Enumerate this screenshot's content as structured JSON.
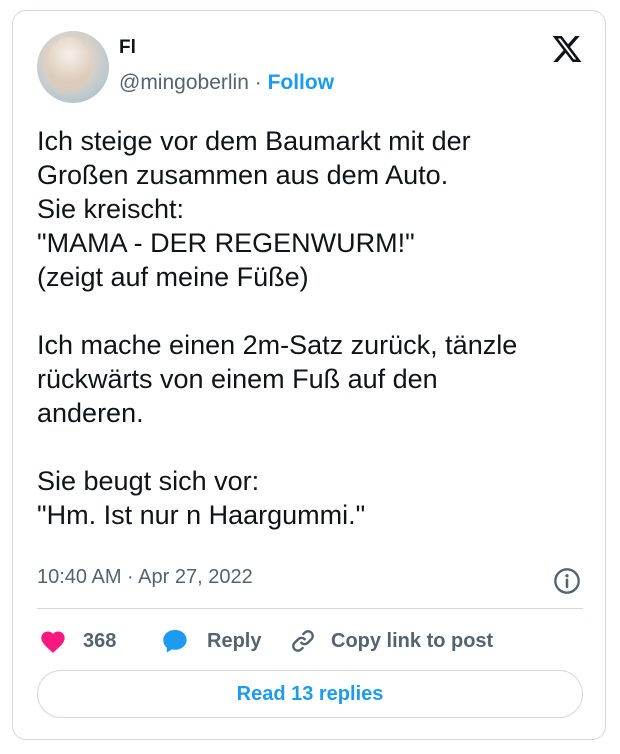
{
  "author": {
    "display_name": "Fl",
    "handle": "@mingoberlin",
    "separator": " · ",
    "follow_label": "Follow"
  },
  "tweet": {
    "text": "Ich steige vor dem Baumarkt mit der\nGroßen zusammen aus dem Auto.\nSie kreischt:\n\"MAMA - DER REGENWURM!\"\n(zeigt auf meine Füße)\n\nIch mache einen 2m-Satz zurück, tänzle\nrückwärts von einem Fuß auf den\nanderen.\n\nSie beugt sich vor:\n\"Hm. Ist nur n Haargummi.\"",
    "timestamp": "10:40 AM · Apr 27, 2022"
  },
  "actions": {
    "like_count": "368",
    "reply_label": "Reply",
    "copy_link_label": "Copy link to post",
    "read_replies_label": "Read 13 replies"
  },
  "icons": {
    "logo": "x-logo-icon",
    "info": "info-icon",
    "like": "heart-icon",
    "reply": "speech-bubble-icon",
    "copy": "link-icon"
  },
  "colors": {
    "accent": "#1d9bf0",
    "heart": "#f91880",
    "text": "#0f1419",
    "muted": "#536471",
    "border": "#cfd9de"
  }
}
